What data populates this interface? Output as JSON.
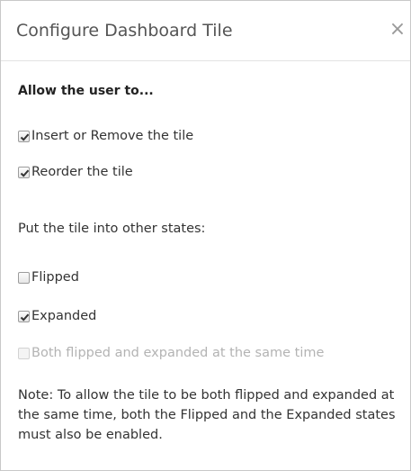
{
  "dialog": {
    "title": "Configure Dashboard Tile",
    "close_glyph": "×"
  },
  "permissions": {
    "heading": "Allow the user to...",
    "options": [
      {
        "label": "Insert or Remove the tile",
        "checked": true,
        "enabled": true
      },
      {
        "label": "Reorder the tile",
        "checked": true,
        "enabled": true
      }
    ]
  },
  "states": {
    "prompt": "Put the tile into other states:",
    "options": [
      {
        "label": "Flipped",
        "checked": false,
        "enabled": true
      },
      {
        "label": "Expanded",
        "checked": true,
        "enabled": true
      },
      {
        "label": "Both flipped and expanded at the same time",
        "checked": false,
        "enabled": false
      }
    ]
  },
  "note": "Note: To allow the tile to be both flipped and expanded at the same time, both the Flipped and the Expanded states must also be enabled.",
  "icons": {
    "close": "close-icon",
    "checkbox_checked": "checkmark-icon"
  }
}
